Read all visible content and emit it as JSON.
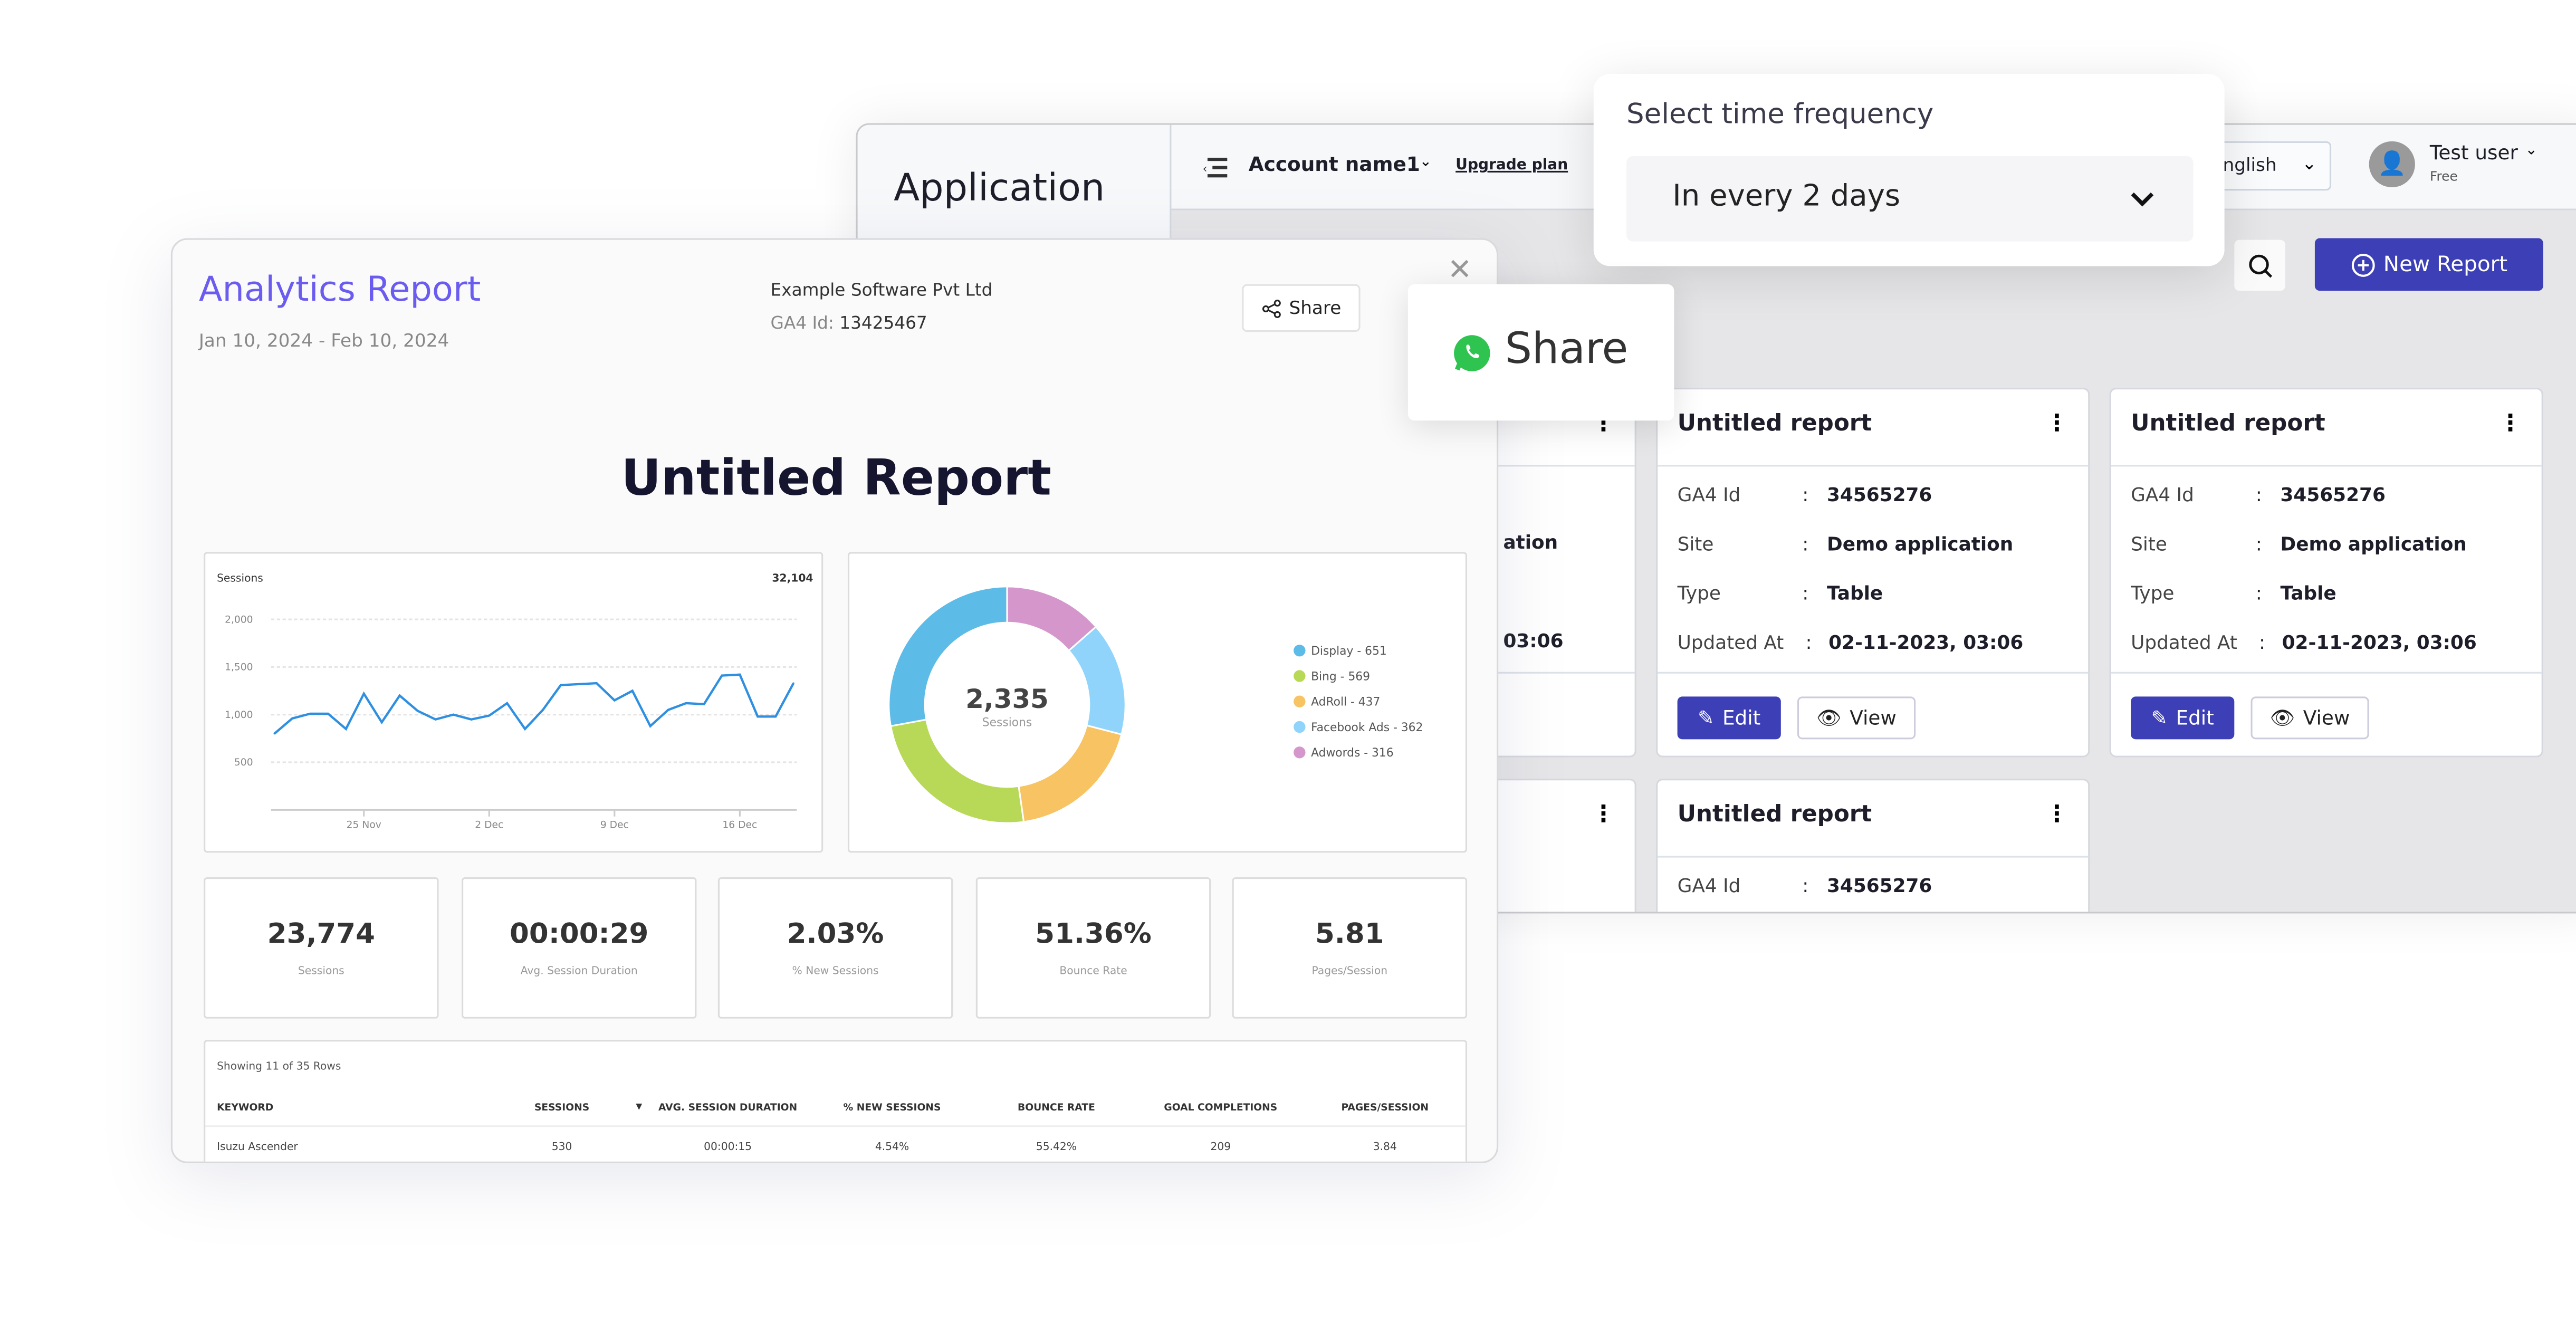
{
  "app": {
    "title": "Application",
    "account": "Account name1",
    "upgrade": "Upgrade plan",
    "language": "nglish",
    "user_name": "Test user",
    "user_plan": "Free",
    "new_report": "New Report"
  },
  "frequency": {
    "title": "Select time frequency",
    "value": "In every 2 days"
  },
  "share_popup": {
    "label": "Share",
    "icon": "whatsapp-icon"
  },
  "cards": [
    {
      "title": "",
      "ga4_value": "",
      "site_value": "ation",
      "updated_value": "03:06"
    },
    {
      "title": "Untitled report",
      "ga4_label": "GA4 Id",
      "ga4_value": "34565276",
      "site_label": "Site",
      "site_value": "Demo application",
      "type_label": "Type",
      "type_value": "Table",
      "updated_label": "Updated At",
      "updated_value": "02-11-2023, 03:06",
      "sep": ":",
      "edit": "Edit",
      "view": "View"
    },
    {
      "title": "Untitled report",
      "ga4_label": "GA4 Id",
      "ga4_value": "34565276",
      "site_label": "Site",
      "site_value": "Demo application",
      "type_label": "Type",
      "type_value": "Table",
      "updated_label": "Updated At",
      "updated_value": "02-11-2023, 03:06",
      "sep": ":",
      "edit": "Edit",
      "view": "View"
    },
    {
      "title": "Untitled report",
      "ga4_label": "GA4 Id",
      "ga4_value": "34565276",
      "sep": ":"
    }
  ],
  "report": {
    "title": "Analytics Report",
    "date_range": "Jan 10, 2024 - Feb 10, 2024",
    "company": "Example Software Pvt Ltd",
    "ga4_label": "GA4 Id:",
    "ga4_value": "13425467",
    "share": "Share",
    "heading": "Untitled Report",
    "accent": "#6a5cf0"
  },
  "kpis": [
    {
      "value": "23,774",
      "label": "Sessions"
    },
    {
      "value": "00:00:29",
      "label": "Avg. Session Duration"
    },
    {
      "value": "2.03%",
      "label": "% New Sessions"
    },
    {
      "value": "51.36%",
      "label": "Bounce Rate"
    },
    {
      "value": "5.81",
      "label": "Pages/Session"
    }
  ],
  "table": {
    "caption": "Showing 11 of 35 Rows",
    "columns": [
      "KEYWORD",
      "SESSIONS",
      "AVG. SESSION DURATION",
      "% NEW SESSIONS",
      "BOUNCE RATE",
      "GOAL COMPLETIONS",
      "PAGES/SESSION"
    ],
    "rows": [
      [
        "Isuzu Ascender",
        "530",
        "00:00:15",
        "4.54%",
        "55.42%",
        "209",
        "3.84"
      ]
    ]
  },
  "chart_data": [
    {
      "type": "line",
      "title": "Sessions",
      "total": "32,104",
      "ylim": [
        0,
        2000
      ],
      "yticks": [
        "500",
        "1,000",
        "1,500",
        "2,000"
      ],
      "xticks": [
        "25 Nov",
        "2 Dec",
        "9 Dec",
        "16 Dec"
      ],
      "grid": true,
      "color": "#2f8fe0",
      "x": [
        "20 Nov",
        "21 Nov",
        "22 Nov",
        "23 Nov",
        "24 Nov",
        "25 Nov",
        "26 Nov",
        "27 Nov",
        "28 Nov",
        "29 Nov",
        "30 Nov",
        "1 Dec",
        "2 Dec",
        "3 Dec",
        "4 Dec",
        "5 Dec",
        "6 Dec",
        "7 Dec",
        "8 Dec",
        "9 Dec",
        "10 Dec",
        "11 Dec",
        "12 Dec",
        "13 Dec",
        "14 Dec",
        "15 Dec",
        "16 Dec",
        "17 Dec",
        "18 Dec",
        "19 Dec"
      ],
      "values": [
        800,
        960,
        1010,
        1010,
        850,
        1220,
        920,
        1200,
        1040,
        950,
        1000,
        950,
        990,
        1120,
        850,
        1050,
        1310,
        1320,
        1330,
        1150,
        1250,
        880,
        1050,
        1120,
        1110,
        1410,
        1420,
        980,
        980,
        1330
      ]
    },
    {
      "type": "pie",
      "center_value": "2,335",
      "center_label": "Sessions",
      "legend": "right",
      "slices": [
        {
          "name": "Display - 651",
          "value": 651,
          "color": "#5dbbe8"
        },
        {
          "name": "Bing - 569",
          "value": 569,
          "color": "#b8d957"
        },
        {
          "name": "AdRoll - 437",
          "value": 437,
          "color": "#f8c362"
        },
        {
          "name": "Facebook Ads - 362",
          "value": 362,
          "color": "#90d4fb"
        },
        {
          "name": "Adwords - 316",
          "value": 316,
          "color": "#d597cb"
        }
      ]
    }
  ]
}
